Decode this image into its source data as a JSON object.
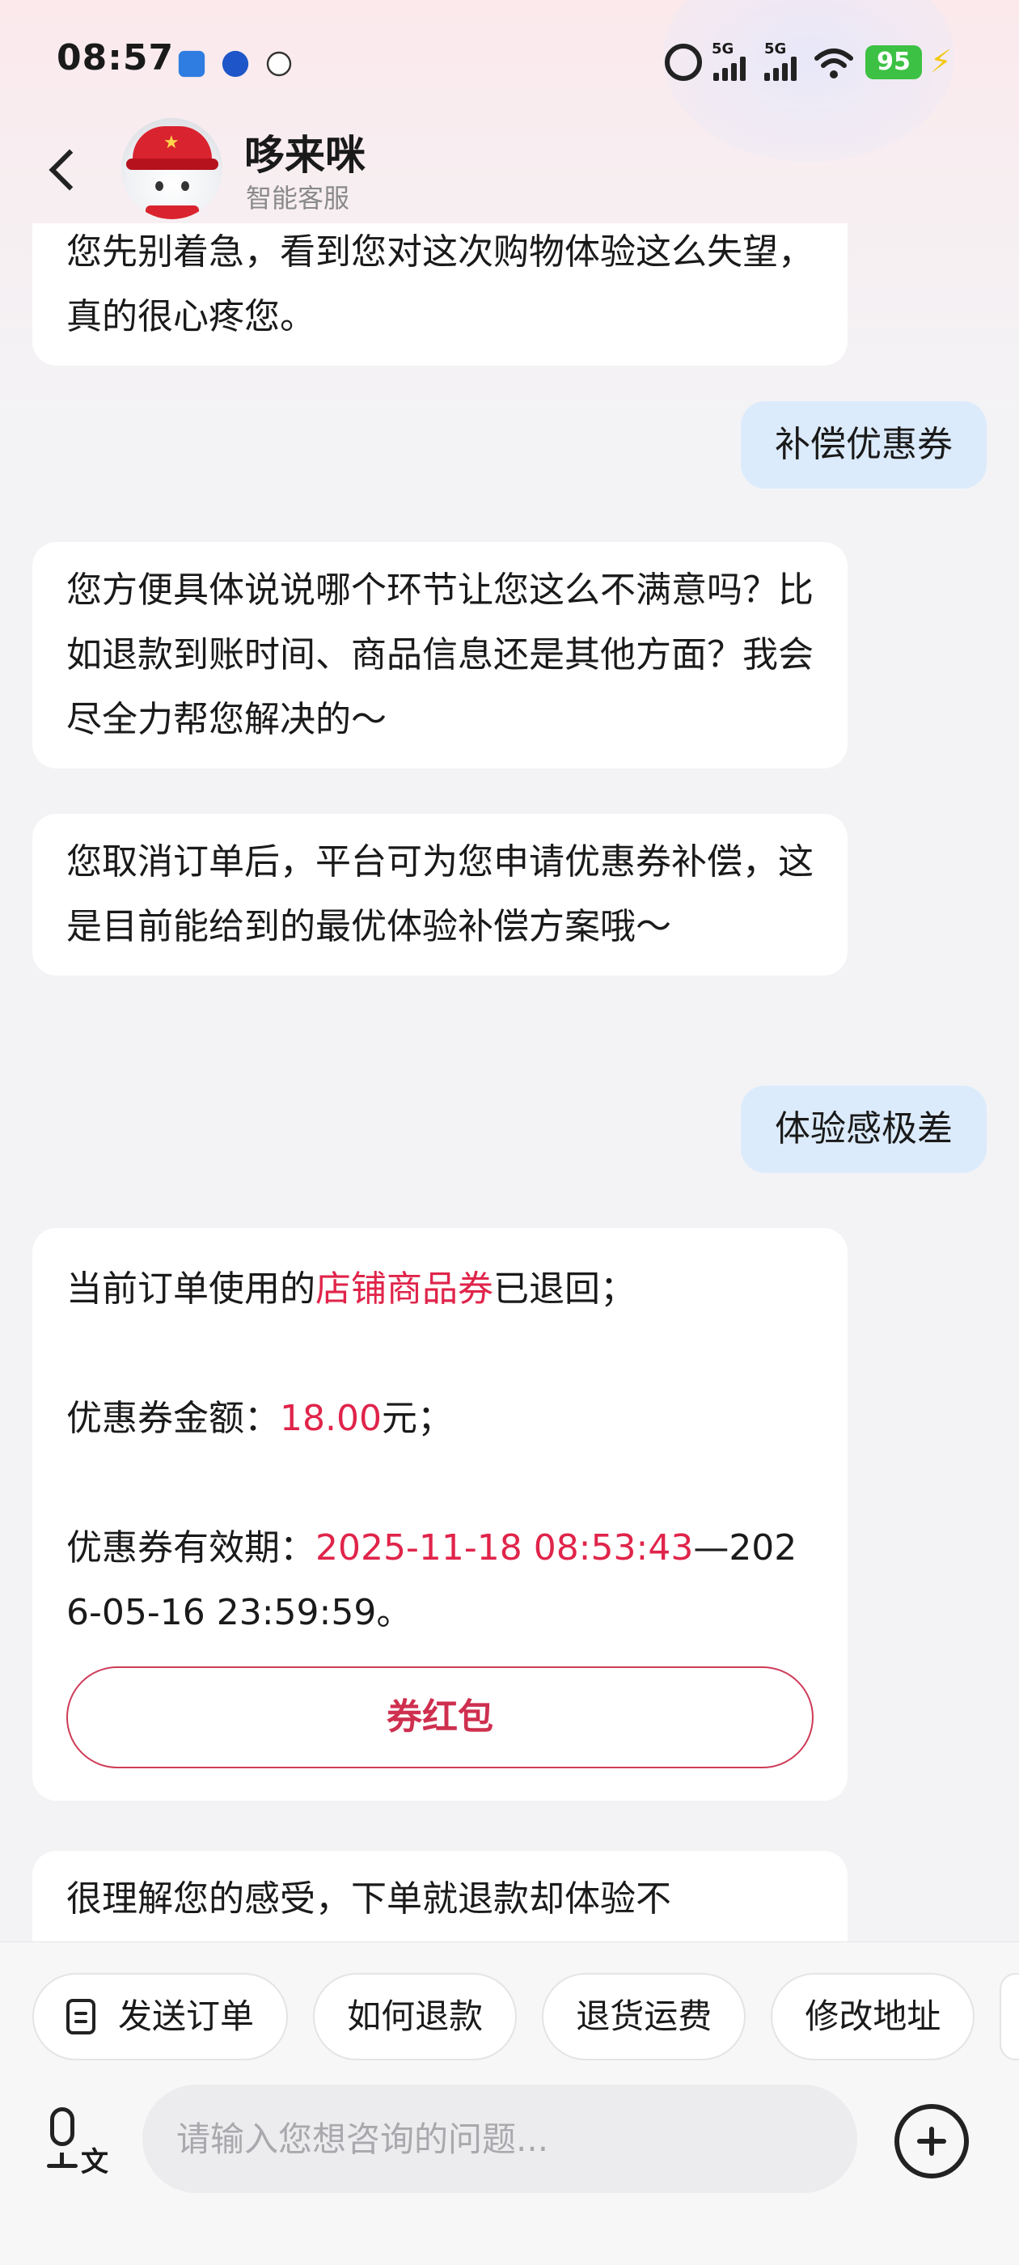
{
  "status_bar": {
    "time": "08:57",
    "network_1": "5G",
    "network_2": "5G",
    "battery": "95"
  },
  "header": {
    "agent_name": "哆来咪",
    "agent_role": "智能客服"
  },
  "messages": [
    {
      "from": "bot",
      "text": "您先别着急，看到您对这次购物体验这么失望，真的很心疼您。"
    },
    {
      "from": "user",
      "text": "补偿优惠券"
    },
    {
      "from": "bot",
      "text": "您方便具体说说哪个环节让您这么不满意吗？比如退款到账时间、商品信息还是其他方面？我会尽全力帮您解决的～"
    },
    {
      "from": "bot",
      "text": "您取消订单后，平台可为您申请优惠券补偿，这是目前能给到的最优体验补偿方案哦～"
    },
    {
      "from": "user",
      "text": "体验感极差"
    },
    {
      "from": "bot",
      "line1_prefix": "当前订单使用的",
      "line1_highlight": "店铺商品券",
      "line1_suffix": "已退回；",
      "line2_prefix": "优惠券金额：",
      "line2_highlight": "18.00",
      "line2_suffix": "元；",
      "line3_prefix": "优惠券有效期：",
      "line3_highlight": "2025-11-18 08:53:43",
      "line3_suffix": "—2026-05-16 23:59:59。",
      "button_label": "券红包"
    },
    {
      "from": "bot",
      "text": "很理解您的感受，下单就退款却体验不"
    }
  ],
  "quick_replies": [
    "发送订单",
    "如何退款",
    "退货运费",
    "修改地址"
  ],
  "input": {
    "placeholder": "请输入您想咨询的问题...",
    "voice_label": "文"
  },
  "colors": {
    "highlight": "#e0244a",
    "user_bubble": "#dcebfb",
    "battery": "#3dc144"
  }
}
